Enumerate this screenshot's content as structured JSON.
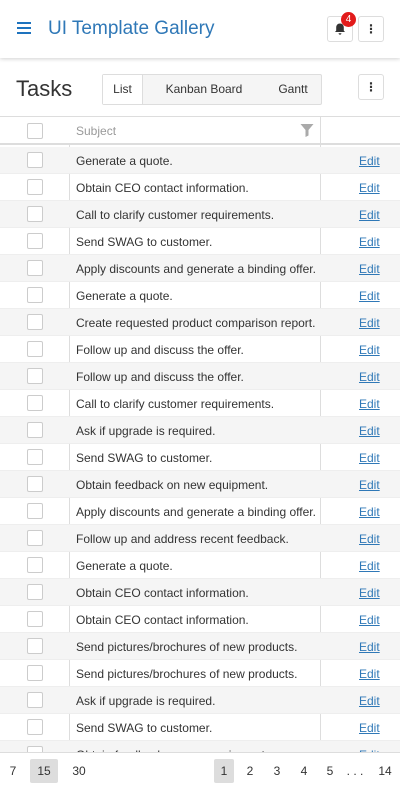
{
  "app": {
    "title": "UI Template Gallery",
    "notification_count": "4"
  },
  "toolbar": {
    "title": "Tasks",
    "tabs": [
      {
        "label": "List",
        "active": true
      },
      {
        "label": "Kanban Board",
        "active": false
      },
      {
        "label": "Gantt",
        "active": false
      }
    ]
  },
  "grid": {
    "header": {
      "subject": "Subject"
    },
    "edit_label": "Edit",
    "rows": [
      {
        "subject": "Generate a quote."
      },
      {
        "subject": "Obtain CEO contact information."
      },
      {
        "subject": "Call to clarify customer requirements."
      },
      {
        "subject": "Send SWAG to customer."
      },
      {
        "subject": "Apply discounts and generate a binding offer."
      },
      {
        "subject": "Generate a quote."
      },
      {
        "subject": "Create requested product comparison report."
      },
      {
        "subject": "Follow up and discuss the offer."
      },
      {
        "subject": "Follow up and discuss the offer."
      },
      {
        "subject": "Call to clarify customer requirements."
      },
      {
        "subject": "Ask if upgrade is required."
      },
      {
        "subject": "Send SWAG to customer."
      },
      {
        "subject": "Obtain feedback on new equipment."
      },
      {
        "subject": "Apply discounts and generate a binding offer."
      },
      {
        "subject": "Follow up and address recent feedback."
      },
      {
        "subject": "Generate a quote."
      },
      {
        "subject": "Obtain CEO contact information."
      },
      {
        "subject": "Obtain CEO contact information."
      },
      {
        "subject": "Send pictures/brochures of new products."
      },
      {
        "subject": "Send pictures/brochures of new products."
      },
      {
        "subject": "Ask if upgrade is required."
      },
      {
        "subject": "Send SWAG to customer."
      },
      {
        "subject": "Obtain feedback on new equipment."
      }
    ]
  },
  "pager": {
    "page_sizes": [
      {
        "label": "7",
        "selected": false
      },
      {
        "label": "15",
        "selected": true
      },
      {
        "label": "30",
        "selected": false
      }
    ],
    "pages": [
      {
        "label": "1",
        "selected": true
      },
      {
        "label": "2",
        "selected": false
      },
      {
        "label": "3",
        "selected": false
      },
      {
        "label": "4",
        "selected": false
      },
      {
        "label": "5",
        "selected": false
      }
    ],
    "ellipsis": ". . .",
    "last_page": "14"
  },
  "icons": {
    "menu": "hamburger-menu-icon",
    "bell": "bell-icon",
    "more": "more-vertical-icon",
    "filter": "filter-icon"
  },
  "colors": {
    "accent": "#2f78b7",
    "badge": "#e21b1b",
    "alt_row": "#f5f5f5",
    "selected_page": "#dddddd"
  }
}
